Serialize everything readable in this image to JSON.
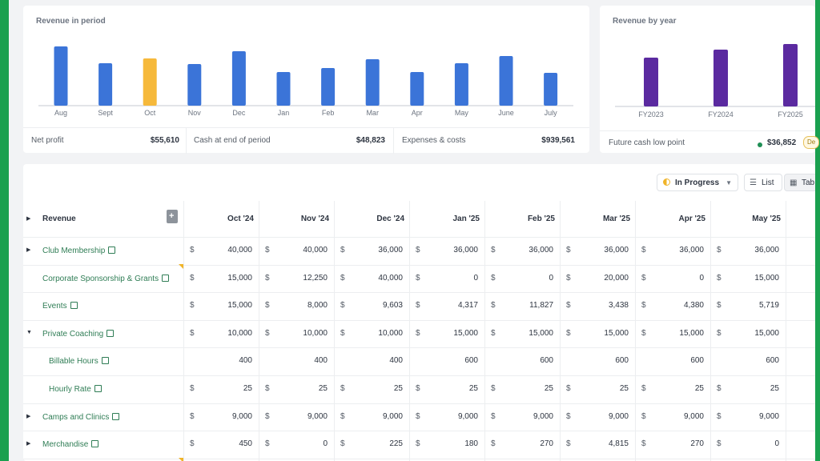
{
  "revenue_chart": {
    "title": "Revenue in period",
    "chart_data": {
      "type": "bar",
      "categories": [
        "Aug",
        "Sept",
        "Oct",
        "Nov",
        "Dec",
        "Jan",
        "Feb",
        "Mar",
        "Apr",
        "May",
        "June",
        "July"
      ],
      "values": [
        74,
        53,
        59,
        52,
        68,
        42,
        47,
        58,
        42,
        53,
        62,
        41
      ],
      "highlight_index": 2,
      "colors": {
        "bar": "#3b74d8",
        "highlight": "#f6b93b"
      }
    }
  },
  "stats": [
    {
      "label": "Net profit",
      "value": "$55,610"
    },
    {
      "label": "Cash at end of period",
      "value": "$48,823"
    },
    {
      "label": "Expenses & costs",
      "value": "$939,561"
    }
  ],
  "yearly_chart": {
    "title": "Revenue by year",
    "chart_data": {
      "type": "bar",
      "categories": [
        "FY2023",
        "FY2024",
        "FY2025"
      ],
      "values": [
        61,
        71,
        78
      ],
      "color": "#5b2aa0"
    }
  },
  "future_cash": {
    "label": "Future cash low point",
    "value": "$36,852",
    "badge": "De"
  },
  "toolbar": {
    "status": "In Progress",
    "list": "List",
    "table": "Tab"
  },
  "table": {
    "first_header": "Revenue",
    "months": [
      "Oct '24",
      "Nov '24",
      "Dec '24",
      "Jan '25",
      "Feb '25",
      "Mar '25",
      "Apr '25",
      "May '25"
    ],
    "rows": [
      {
        "label": "Club Membership",
        "expander": "right",
        "indent": false,
        "dollar": true,
        "values": [
          "40,000",
          "40,000",
          "36,000",
          "36,000",
          "36,000",
          "36,000",
          "36,000",
          "36,000"
        ]
      },
      {
        "label": "Corporate Sponsorship & Grants",
        "expander": "",
        "indent": false,
        "dollar": true,
        "values": [
          "15,000",
          "12,250",
          "40,000",
          "0",
          "0",
          "20,000",
          "0",
          "15,000"
        ]
      },
      {
        "label": "Events",
        "expander": "",
        "indent": false,
        "dollar": true,
        "values": [
          "15,000",
          "8,000",
          "9,603",
          "4,317",
          "11,827",
          "3,438",
          "4,380",
          "5,719"
        ]
      },
      {
        "label": "Private Coaching",
        "expander": "down",
        "indent": false,
        "dollar": true,
        "values": [
          "10,000",
          "10,000",
          "10,000",
          "15,000",
          "15,000",
          "15,000",
          "15,000",
          "15,000"
        ]
      },
      {
        "label": "Billable Hours",
        "expander": "",
        "indent": true,
        "dollar": false,
        "values": [
          "400",
          "400",
          "400",
          "600",
          "600",
          "600",
          "600",
          "600"
        ]
      },
      {
        "label": "Hourly Rate",
        "expander": "",
        "indent": true,
        "dollar": true,
        "values": [
          "25",
          "25",
          "25",
          "25",
          "25",
          "25",
          "25",
          "25"
        ]
      },
      {
        "label": "Camps and Clinics",
        "expander": "right",
        "indent": false,
        "dollar": true,
        "values": [
          "9,000",
          "9,000",
          "9,000",
          "9,000",
          "9,000",
          "9,000",
          "9,000",
          "9,000"
        ]
      },
      {
        "label": "Merchandise",
        "expander": "right",
        "indent": false,
        "dollar": true,
        "values": [
          "450",
          "0",
          "225",
          "180",
          "270",
          "4,815",
          "270",
          "0"
        ]
      }
    ],
    "currency_symbol": "$"
  }
}
